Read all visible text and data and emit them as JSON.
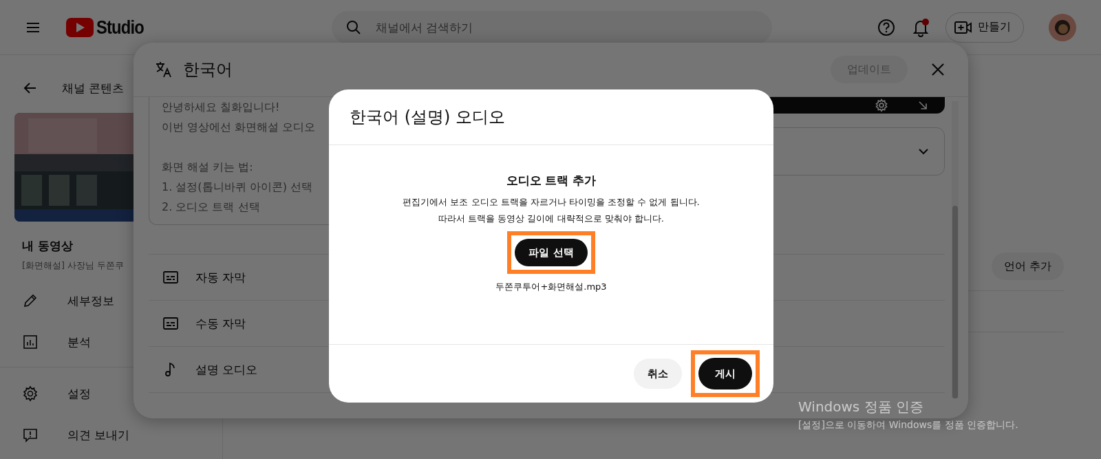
{
  "header": {
    "logo_text": "Studio",
    "search": {
      "placeholder": "채널에서 검색하기"
    },
    "notification_unread": true,
    "create_button": "만들기"
  },
  "sidebar": {
    "back_label": "채널 콘텐츠",
    "section_title": "내 동영상",
    "video_title": "[화면해설] 사장님 두쫀쿠",
    "items": [
      {
        "label": "세부정보"
      },
      {
        "label": "분석"
      }
    ],
    "bottom_items": [
      {
        "label": "설정"
      },
      {
        "label": "의견 보내기"
      }
    ]
  },
  "main": {
    "add_language_button": "언어 추가"
  },
  "panel": {
    "title": "한국어",
    "update_button": {
      "label": "업데이트",
      "disabled": true
    },
    "description_paragraphs": [
      [
        "안녕하세요 칠화입니다!",
        "이번 영상에선 화면해설 오디오"
      ],
      [
        "화면 해설 키는 법:",
        "1. 설정(톱니바퀴 아이콘) 선택",
        "2. 오디오 트랙 선택"
      ]
    ],
    "rows": [
      {
        "label": "자동 자막"
      },
      {
        "label": "수동 자막"
      },
      {
        "label": "설명 오디오"
      }
    ]
  },
  "modal": {
    "title": "한국어 (설명) 오디오",
    "heading": "오디오 트랙 추가",
    "lines": [
      "편집기에서 보조 오디오 트랙을 자르거나 타이밍을 조정할 수 없게 됩니다.",
      "따라서 트랙을 동영상 길이에 대략적으로 맞춰야 합니다."
    ],
    "file_button": {
      "label": "파일 선택",
      "highlighted": true
    },
    "file_name": "두쫀쿠투어+화면해설.mp3",
    "cancel_button": {
      "label": "취소",
      "highlighted": false
    },
    "publish_button": {
      "label": "게시",
      "highlighted": true
    }
  },
  "os_notice": {
    "title": "Windows 정품 인증",
    "subtitle": "[설정]으로 이동하여 Windows를 정품 인증합니다."
  }
}
